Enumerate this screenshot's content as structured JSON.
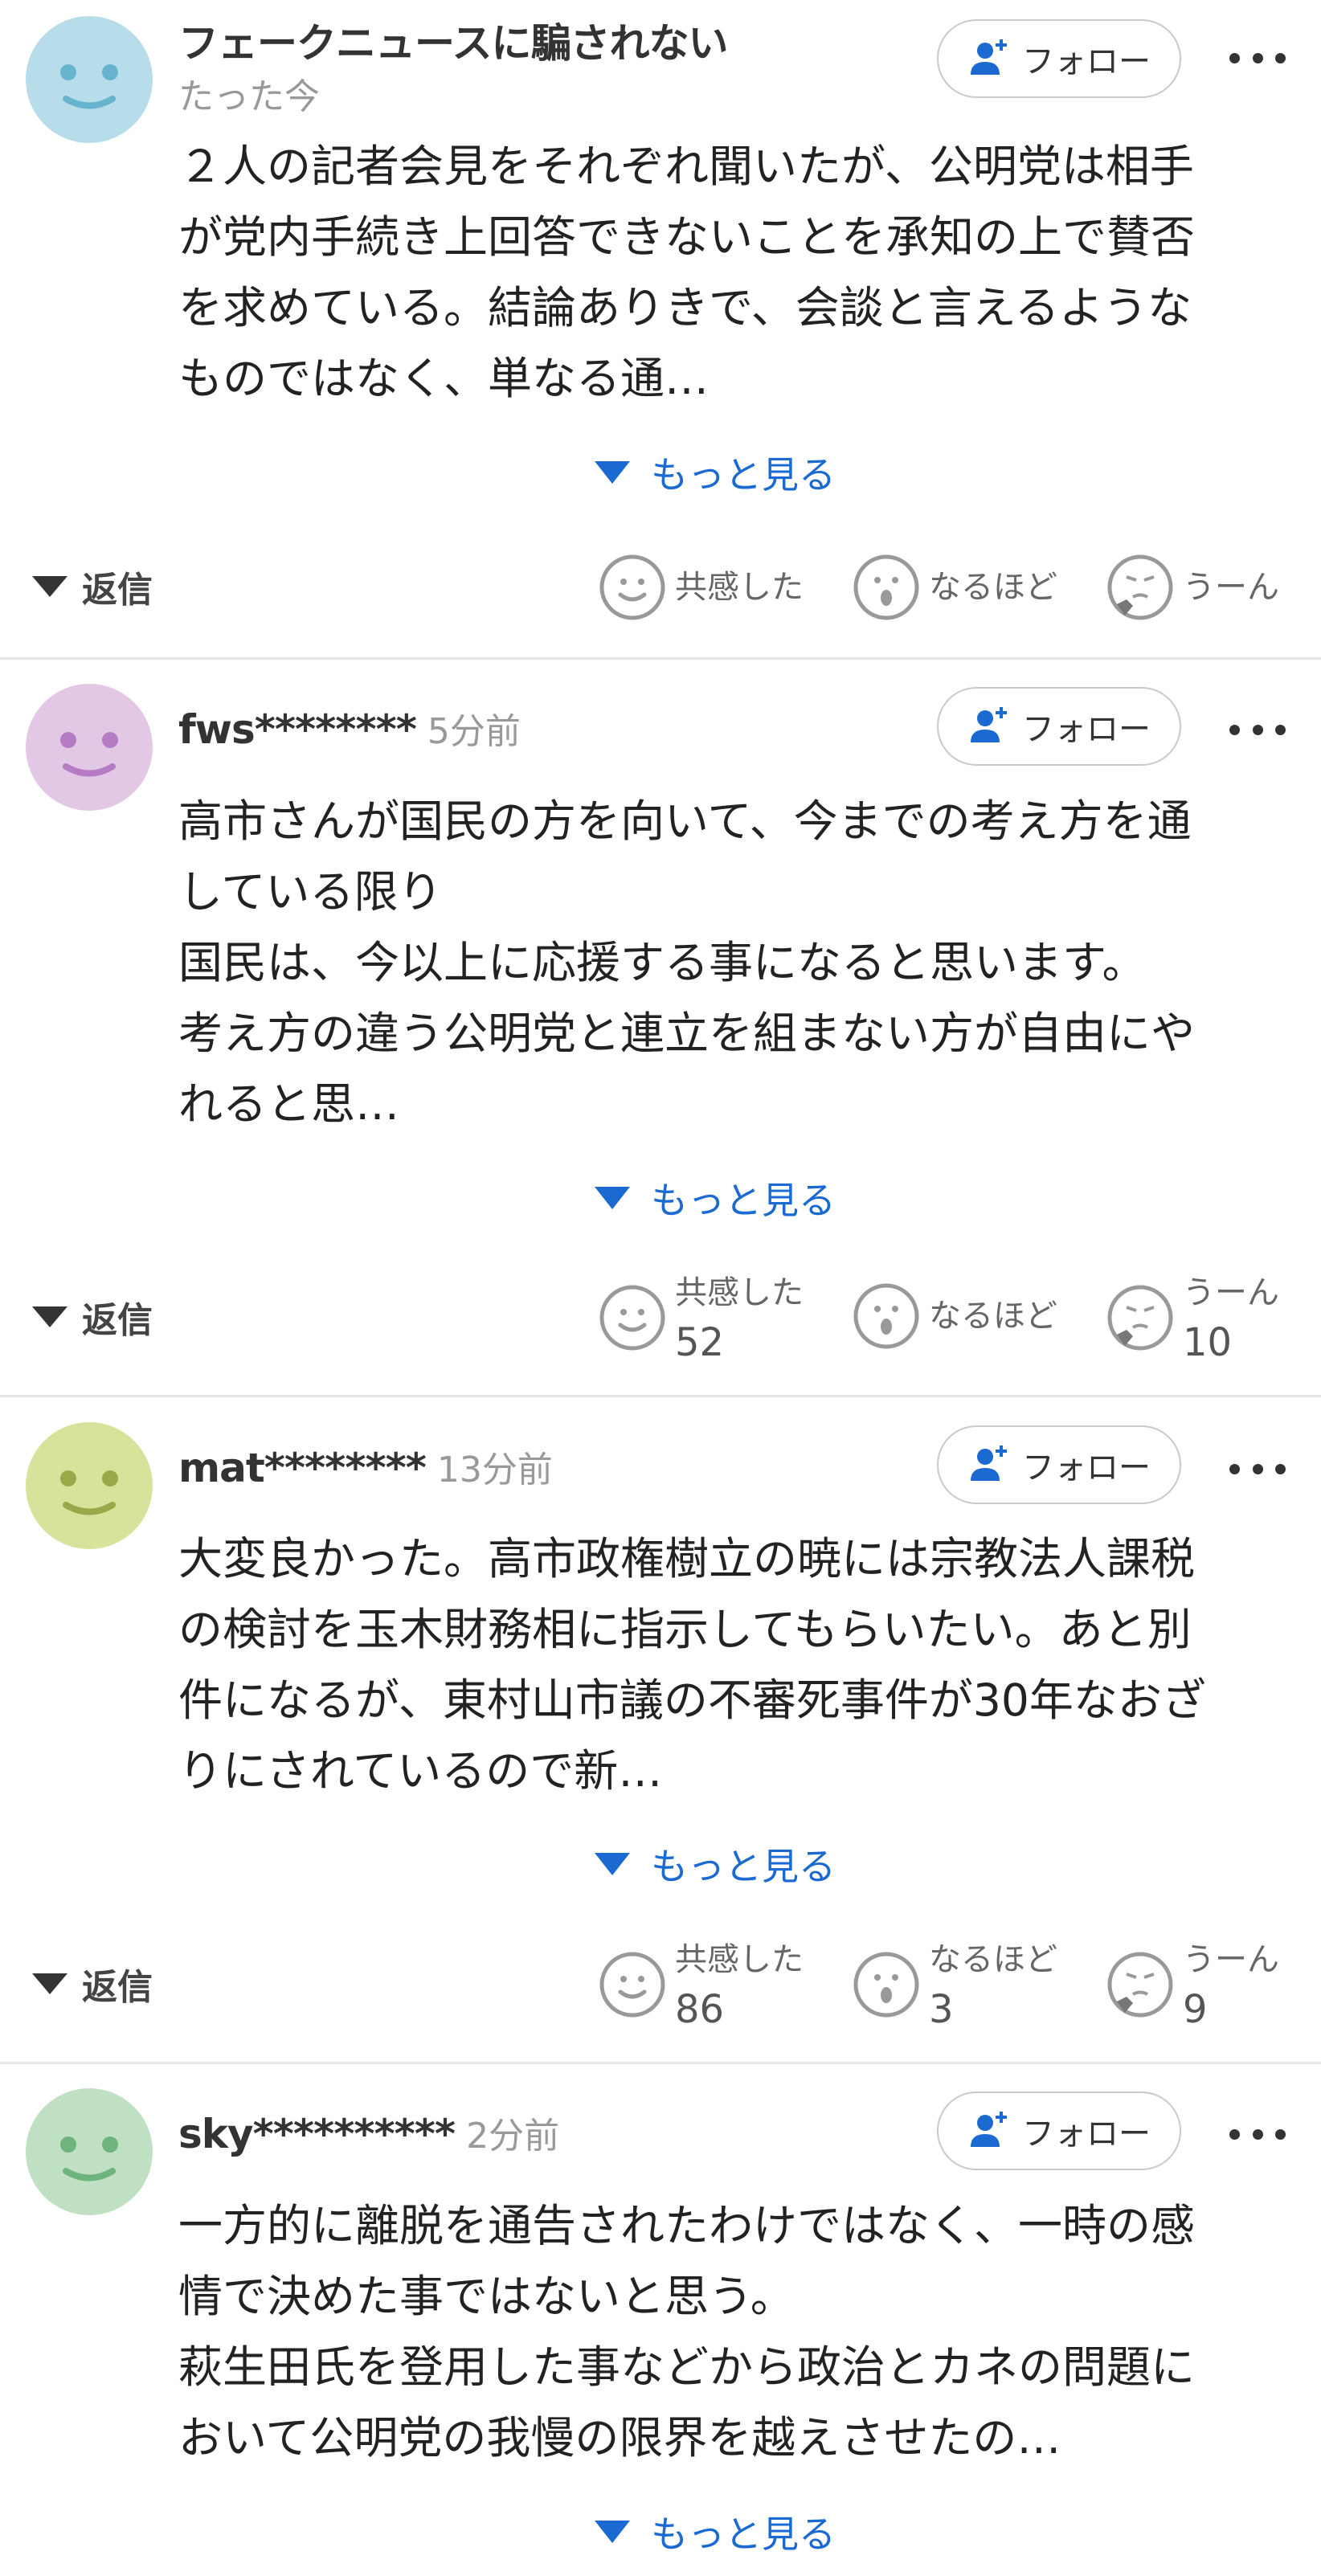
{
  "follow_label": "フォロー",
  "see_more_label": "もっと見る",
  "reply_label": "返信",
  "reaction_labels": {
    "empathy": "共感した",
    "naruhodo": "なるほど",
    "uun": "うーん"
  },
  "comments": [
    {
      "username": "フェークニュースに騙されない",
      "time": "たった今",
      "avatar_color": "#b7dcea",
      "avatar_face_color": "#68b4cf",
      "body": "２人の記者会見をそれぞれ聞いたが、公明党は相手\nが党内手続き上回答できないことを承知の上で賛否\nを求めている。結論ありきで、会談と言えるような\nものではなく、単なる通…",
      "counts": {
        "empathy": "",
        "naruhodo": "",
        "uun": ""
      }
    },
    {
      "username": "fws********",
      "time": "5分前",
      "avatar_color": "#e3c8e6",
      "avatar_face_color": "#b57cc4",
      "body": "高市さんが国民の方を向いて、今までの考え方を通\nしている限り\n国民は、今以上に応援する事になると思います。\n考え方の違う公明党と連立を組まない方が自由にや\nれると思…",
      "counts": {
        "empathy": "52",
        "naruhodo": "",
        "uun": "10"
      }
    },
    {
      "username": "mat********",
      "time": "13分前",
      "avatar_color": "#d8e29a",
      "avatar_face_color": "#9aa84a",
      "body": "大変良かった。高市政権樹立の暁には宗教法人課税\nの検討を玉木財務相に指示してもらいたい。あと別\n件になるが、東村山市議の不審死事件が30年なおざ\nりにされているので新…",
      "counts": {
        "empathy": "86",
        "naruhodo": "3",
        "uun": "9"
      }
    },
    {
      "username": "sky**********",
      "time": "2分前",
      "avatar_color": "#bfe0c3",
      "avatar_face_color": "#6fb37e",
      "body": "一方的に離脱を通告されたわけではなく、一時の感\n情で決めた事ではないと思う。\n萩生田氏を登用した事などから政治とカネの問題に\nおいて公明党の我慢の限界を越えさせたの…",
      "counts": {
        "empathy": "",
        "naruhodo": "",
        "uun": ""
      }
    }
  ]
}
